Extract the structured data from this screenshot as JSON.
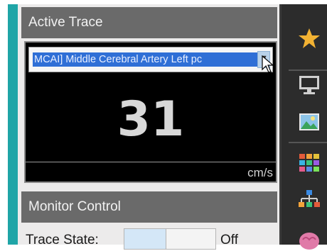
{
  "panel": {
    "active_trace": {
      "header": "Active Trace",
      "selected_trace": "MCAI] Middle Cerebral Artery Left pc",
      "value": "31",
      "unit": "cm/s"
    },
    "monitor_control": {
      "header": "Monitor Control",
      "trace_state_label": "Trace State:",
      "trace_state_value": "Off"
    }
  },
  "toolbar": {
    "icons": [
      "star-icon",
      "monitor-icon",
      "image-icon",
      "grid-icon",
      "network-icon",
      "misc-icon"
    ]
  },
  "colors": {
    "accent_teal": "#1fa5a7",
    "header_gray": "#6a6a6a",
    "selection_blue": "#2f6fd6",
    "star_yellow": "#f2b233"
  }
}
